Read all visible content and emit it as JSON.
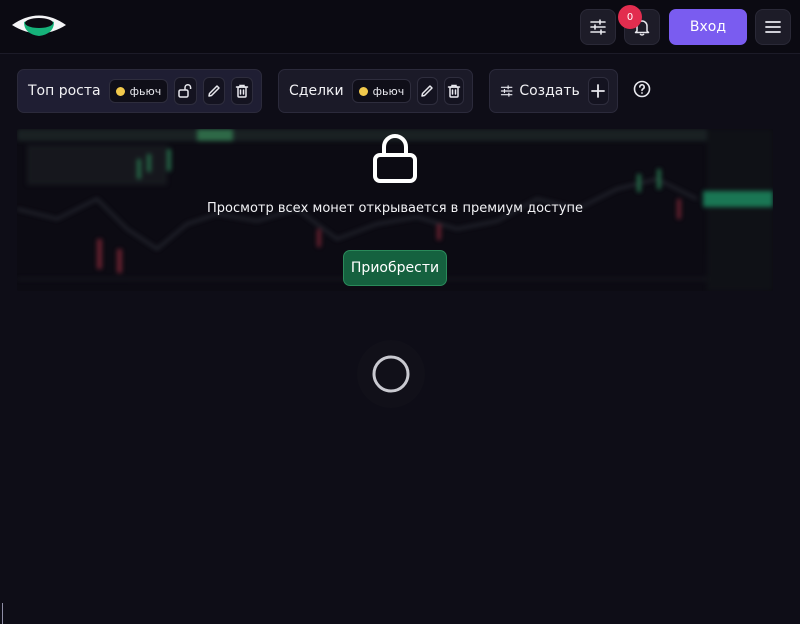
{
  "header": {
    "notification_count": "0",
    "login_label": "Вход"
  },
  "filters": [
    {
      "label": "Топ роста",
      "chip_label": "фьюч"
    },
    {
      "label": "Сделки",
      "chip_label": "фьюч"
    },
    {
      "label": "Создать"
    }
  ],
  "premium": {
    "message": "Просмотр всех монет открывается в премиум доступе",
    "buy_label": "Приобрести"
  },
  "colors": {
    "accent": "#7a5cf0",
    "badge": "#e22d4f",
    "buy": "#15613f",
    "chip_dot": "#f2c94c"
  },
  "icons": [
    "eye-logo-icon",
    "sliders-icon",
    "bell-icon",
    "menu-icon",
    "unlock-icon",
    "pencil-icon",
    "trash-icon",
    "plus-icon",
    "help-circle-icon",
    "lock-icon",
    "loading-spinner-icon"
  ]
}
